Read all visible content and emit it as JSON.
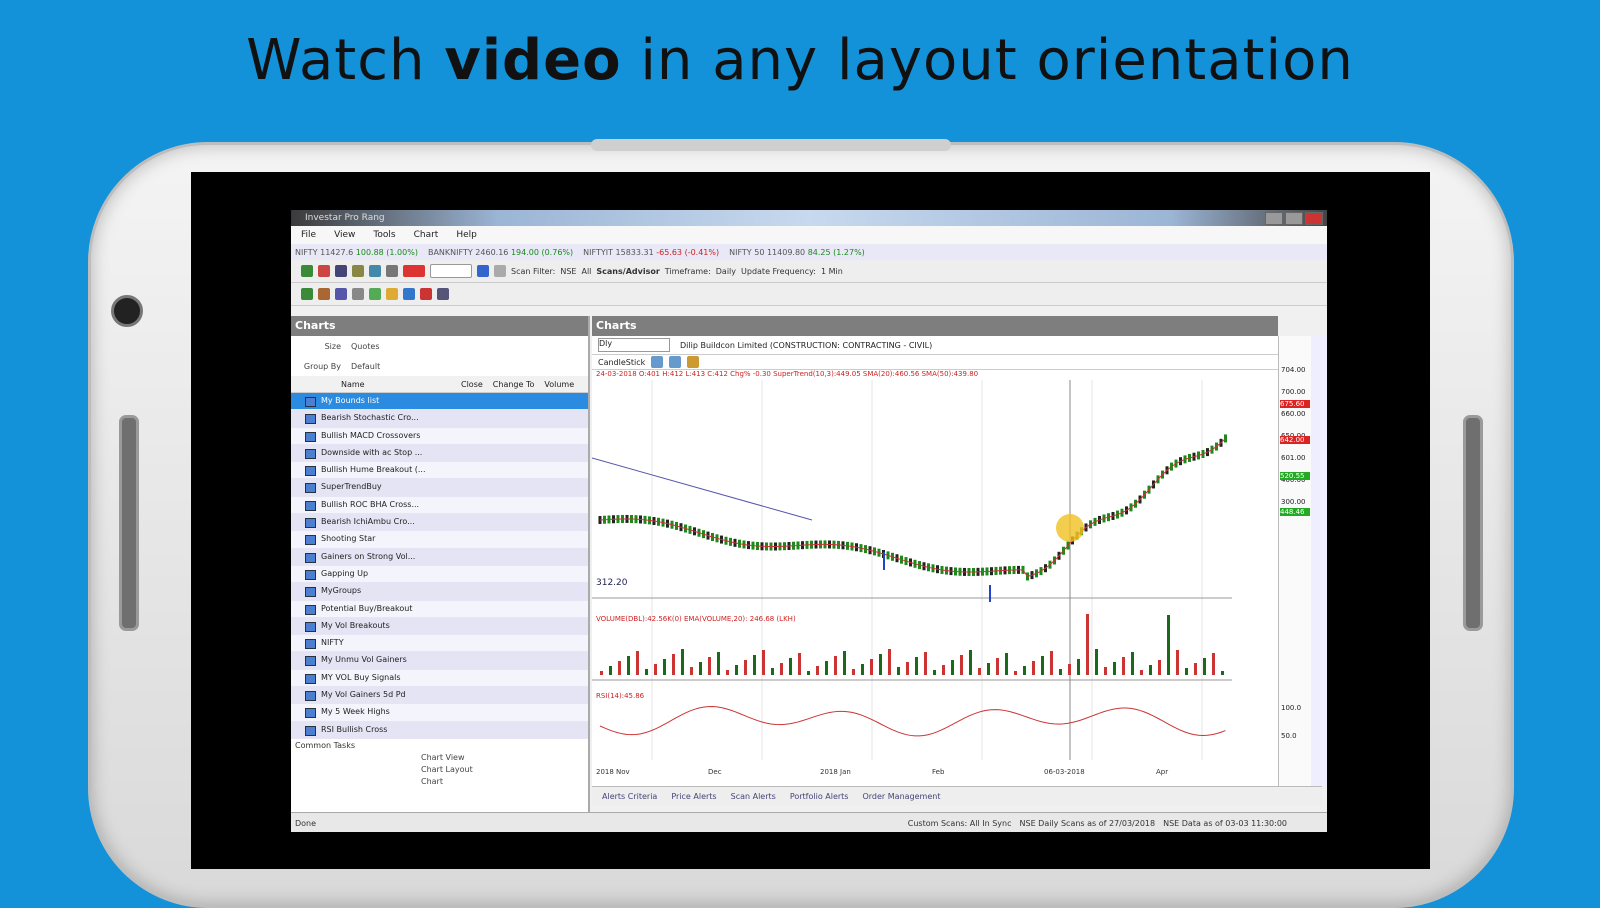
{
  "headline": {
    "pre": "Watch ",
    "bold": "video",
    "post": " in any layout orientation"
  },
  "window": {
    "title": "Investar Pro Rang"
  },
  "menu": [
    "File",
    "View",
    "Tools",
    "Chart",
    "Help"
  ],
  "ticker": [
    {
      "name": "NIFTY",
      "value": "11427.6",
      "change": "100.88 (1.00%)",
      "dir": "up"
    },
    {
      "name": "BANKNIFTY",
      "value": "2460.16",
      "change": "194.00 (0.76%)",
      "dir": "up"
    },
    {
      "name": "NIFTYIT",
      "value": "15833.31",
      "change": "-65.63 (-0.41%)",
      "dir": "dn"
    },
    {
      "name": "NIFTY 50",
      "value": "11409.80",
      "change": "84.25 (1.27%)",
      "dir": "up"
    }
  ],
  "toolbar": {
    "scan_filter_label": "Scan Filter:",
    "scan_filter_value": "NSE",
    "all_label": "All",
    "scans_label": "Scans/Advisor",
    "timeframe_label": "Timeframe:",
    "timeframe_value": "Daily",
    "update_label": "Update Frequency:",
    "update_value": "1 Min"
  },
  "left_pane": {
    "title": "Charts",
    "size_label": "Size",
    "size_value": "Quotes",
    "group_label": "Group By",
    "group_value": "Default",
    "col_name": "Name",
    "col_close": "Close",
    "col_change": "Change To",
    "col_volume": "Volume",
    "items": [
      "My Bounds list",
      "Bearish Stochastic Cro...",
      "Bullish MACD Crossovers",
      "Downside with ac Stop ...",
      "Bullish Hume Breakout (...",
      "SuperTrendBuy",
      "Bullish ROC BHA Cross...",
      "Bearish IchiAmbu Cro...",
      "Shooting Star",
      "Gainers on Strong Vol...",
      "Gapping Up",
      "MyGroups",
      "Potential Buy/Breakout",
      "My Vol Breakouts",
      "NIFTY",
      "My Unmu Vol Gainers",
      "MY VOL Buy Signals",
      "My Vol Gainers 5d Pd",
      "My 5 Week Highs",
      "RSI Bullish Cross"
    ],
    "common_tasks": "Common Tasks",
    "links": [
      "Chart View",
      "Chart Layout",
      "Chart"
    ]
  },
  "chart_pane": {
    "title": "Charts",
    "period": "Dly",
    "symbol": "Dilip Buildcon Limited (CONSTRUCTION: CONTRACTING - CIVIL)",
    "style": "CandleStick",
    "info": "24-03-2018 O:401 H:412 L:413 C:412 Chg% -0.30 SuperTrend(10,3):449.05 SMA(20):460.56 SMA(50):439.80",
    "low_label": "312.20",
    "volume_info": "VOLUME(DBL):42.56K(0)  EMA(VOLUME,20):  246.68 (LKH)",
    "rsi_info": "RSI(14):45.86",
    "x_labels": [
      "2018 Nov",
      "Dec",
      "2018 Jan",
      "Feb",
      "06-03-2018",
      "Apr"
    ],
    "price_levels": [
      "704.00",
      "700.00",
      "660.00",
      "650.00",
      "601.00",
      "400.00",
      "300.00"
    ],
    "price_badges": [
      "675.60",
      "642.00",
      "520.55",
      "448.46"
    ],
    "rsi_levels": [
      "100.0",
      "50.0"
    ]
  },
  "bottom_tabs": [
    "Alerts Criteria",
    "Price Alerts",
    "Scan Alerts",
    "Portfolio Alerts",
    "Order Management"
  ],
  "status": {
    "left": "Done",
    "items": [
      "Custom Scans: All In Sync",
      "NSE Daily Scans as of 27/03/2018",
      "NSE Data as of 03-03 11:30:00"
    ]
  },
  "colors": {
    "bg": "#1391d9",
    "up": "#1a8a1a",
    "down": "#c22222",
    "selection": "#2a8be0"
  }
}
